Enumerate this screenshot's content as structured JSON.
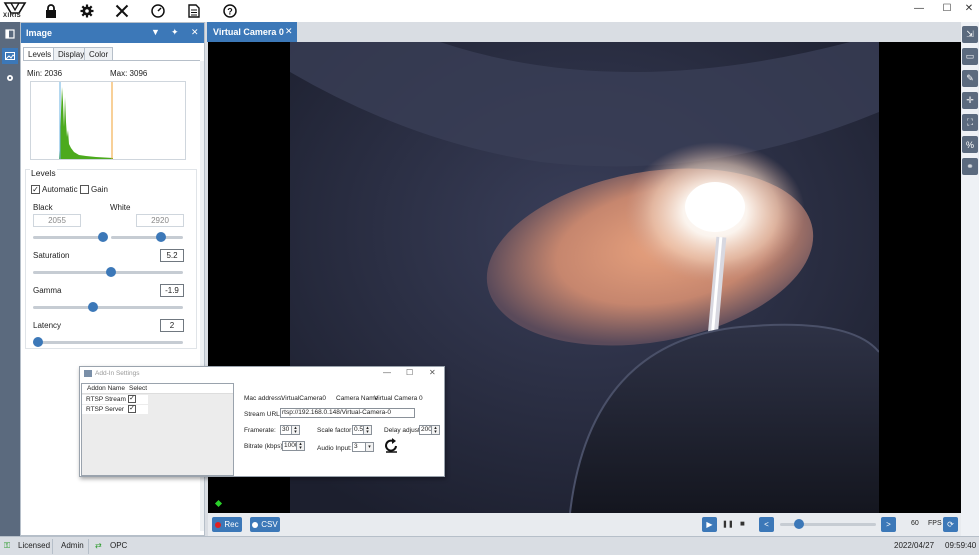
{
  "app": {
    "logo_text": "XIRIS",
    "toolbar_icons": [
      "camera-grid-icon",
      "lock-icon",
      "gear-icon",
      "tools-icon",
      "gauge-icon",
      "document-icon",
      "help-icon"
    ],
    "window_controls": {
      "minimize": "—",
      "maximize": "☐",
      "close": "✕"
    }
  },
  "left_rail": {
    "icons": [
      "camera-list-icon",
      "image-icon",
      "settings-gear-icon"
    ]
  },
  "right_rail": {
    "icons": [
      "export-icon",
      "speech-icon",
      "pen-icon",
      "crosshair-icon",
      "frame-icon",
      "percent-icon",
      "link-icon"
    ]
  },
  "panel": {
    "title": "Image",
    "tabs": [
      "Levels",
      "Display",
      "Color"
    ],
    "active_tab": "Levels",
    "histogram": {
      "min_label": "Min: 2036",
      "max_label": "Max: 3096",
      "fill_color": "#4caa1e"
    },
    "levels": {
      "section_title": "Levels",
      "automatic_label": "Automatic",
      "automatic_checked": true,
      "gain_label": "Gain",
      "gain_checked": false,
      "black_label": "Black",
      "white_label": "White",
      "black_value": "2055",
      "white_value": "2920"
    },
    "saturation": {
      "label": "Saturation",
      "value": "5.2",
      "slider": 0.52
    },
    "gamma": {
      "label": "Gamma",
      "value": "-1.9",
      "slider": 0.4
    },
    "latency": {
      "label": "Latency",
      "value": "2",
      "slider": 0.0
    }
  },
  "video": {
    "tab_title": "Virtual Camera 0",
    "tab_close": "✕",
    "rec_label": "Rec",
    "csv_label": "CSV",
    "prev_label": "<",
    "next_label": ">",
    "fps_value": "60",
    "fps_label": "FPS",
    "timeline_position": 0.2
  },
  "addin_dialog": {
    "title": "Add-In Settings",
    "col_name": "Addon Name",
    "col_select": "Select",
    "addons": [
      {
        "name": "RTSP Stream",
        "selected": true
      },
      {
        "name": "RTSP Server",
        "selected": true
      }
    ],
    "mac_label": "Mac address:",
    "mac_value": "VirtualCamera0",
    "camera_name_label": "Camera Name",
    "camera_name_value": "Virtual Camera 0",
    "stream_url_label": "Stream URL:",
    "stream_url_value": "rtsp://192.168.0.148/Virtual-Camera-0",
    "framerate_label": "Framerate:",
    "framerate_value": "30",
    "scale_label": "Scale factor:",
    "scale_value": "0.5",
    "delay_label": "Delay adjust:",
    "delay_value": "200",
    "bitrate_label": "Bitrate (kbps):",
    "bitrate_value": "10000",
    "audio_label": "Audio Input:",
    "audio_value": "3"
  },
  "status": {
    "licensed": "Licensed",
    "admin": "Admin",
    "opc": "OPC",
    "date": "2022/04/27",
    "time": "09:59:40"
  },
  "colors": {
    "accent": "#3c78b8",
    "rail": "#5b6a7e"
  }
}
